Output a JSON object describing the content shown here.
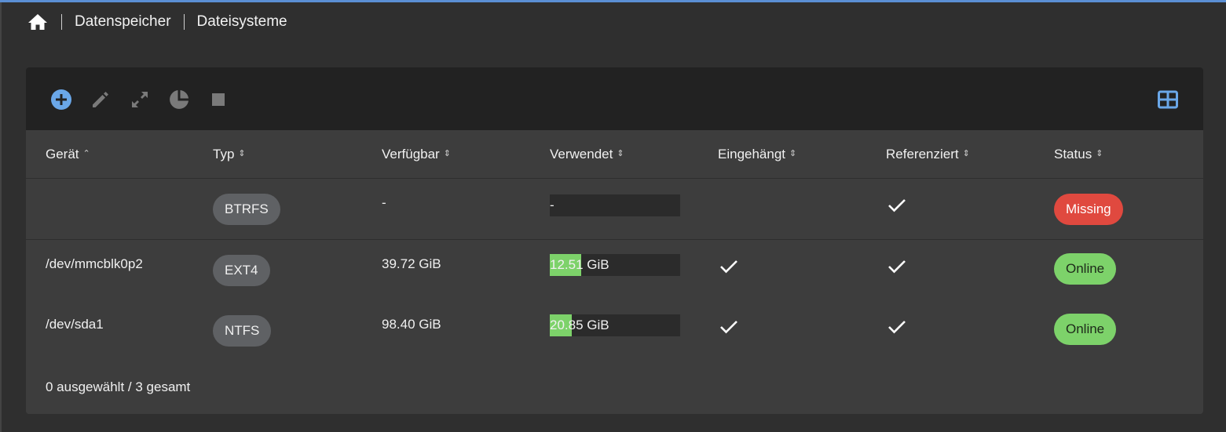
{
  "breadcrumb": {
    "home_icon": "home-icon",
    "items": [
      "Datenspeicher",
      "Dateisysteme"
    ]
  },
  "toolbar": {
    "icons": [
      "plus-circle-icon",
      "pencil-icon",
      "expand-icon",
      "pie-chart-icon",
      "stop-icon",
      "table-layout-icon"
    ],
    "accent_color": "#6aa7e8"
  },
  "table": {
    "columns": [
      {
        "label": "Gerät",
        "sort": "asc"
      },
      {
        "label": "Typ",
        "sort": "none"
      },
      {
        "label": "Verfügbar",
        "sort": "none"
      },
      {
        "label": "Verwendet",
        "sort": "none"
      },
      {
        "label": "Eingehängt",
        "sort": "none"
      },
      {
        "label": "Referenziert",
        "sort": "none"
      },
      {
        "label": "Status",
        "sort": "none"
      }
    ],
    "rows": [
      {
        "device": "",
        "type": "BTRFS",
        "available": "-",
        "used": "-",
        "used_fraction": 0,
        "mounted": false,
        "referenced": true,
        "status": "Missing",
        "status_color": "#e0493f"
      },
      {
        "device": "/dev/mmcblk0p2",
        "type": "EXT4",
        "available": "39.72 GiB",
        "used": "12.51 GiB",
        "used_fraction": 0.24,
        "mounted": true,
        "referenced": true,
        "status": "Online",
        "status_color": "#7dd26a"
      },
      {
        "device": "/dev/sda1",
        "type": "NTFS",
        "available": "98.40 GiB",
        "used": "20.85 GiB",
        "used_fraction": 0.17,
        "mounted": true,
        "referenced": true,
        "status": "Online",
        "status_color": "#7dd26a"
      }
    ]
  },
  "footer": {
    "summary": "0 ausgewählt / 3 gesamt"
  }
}
